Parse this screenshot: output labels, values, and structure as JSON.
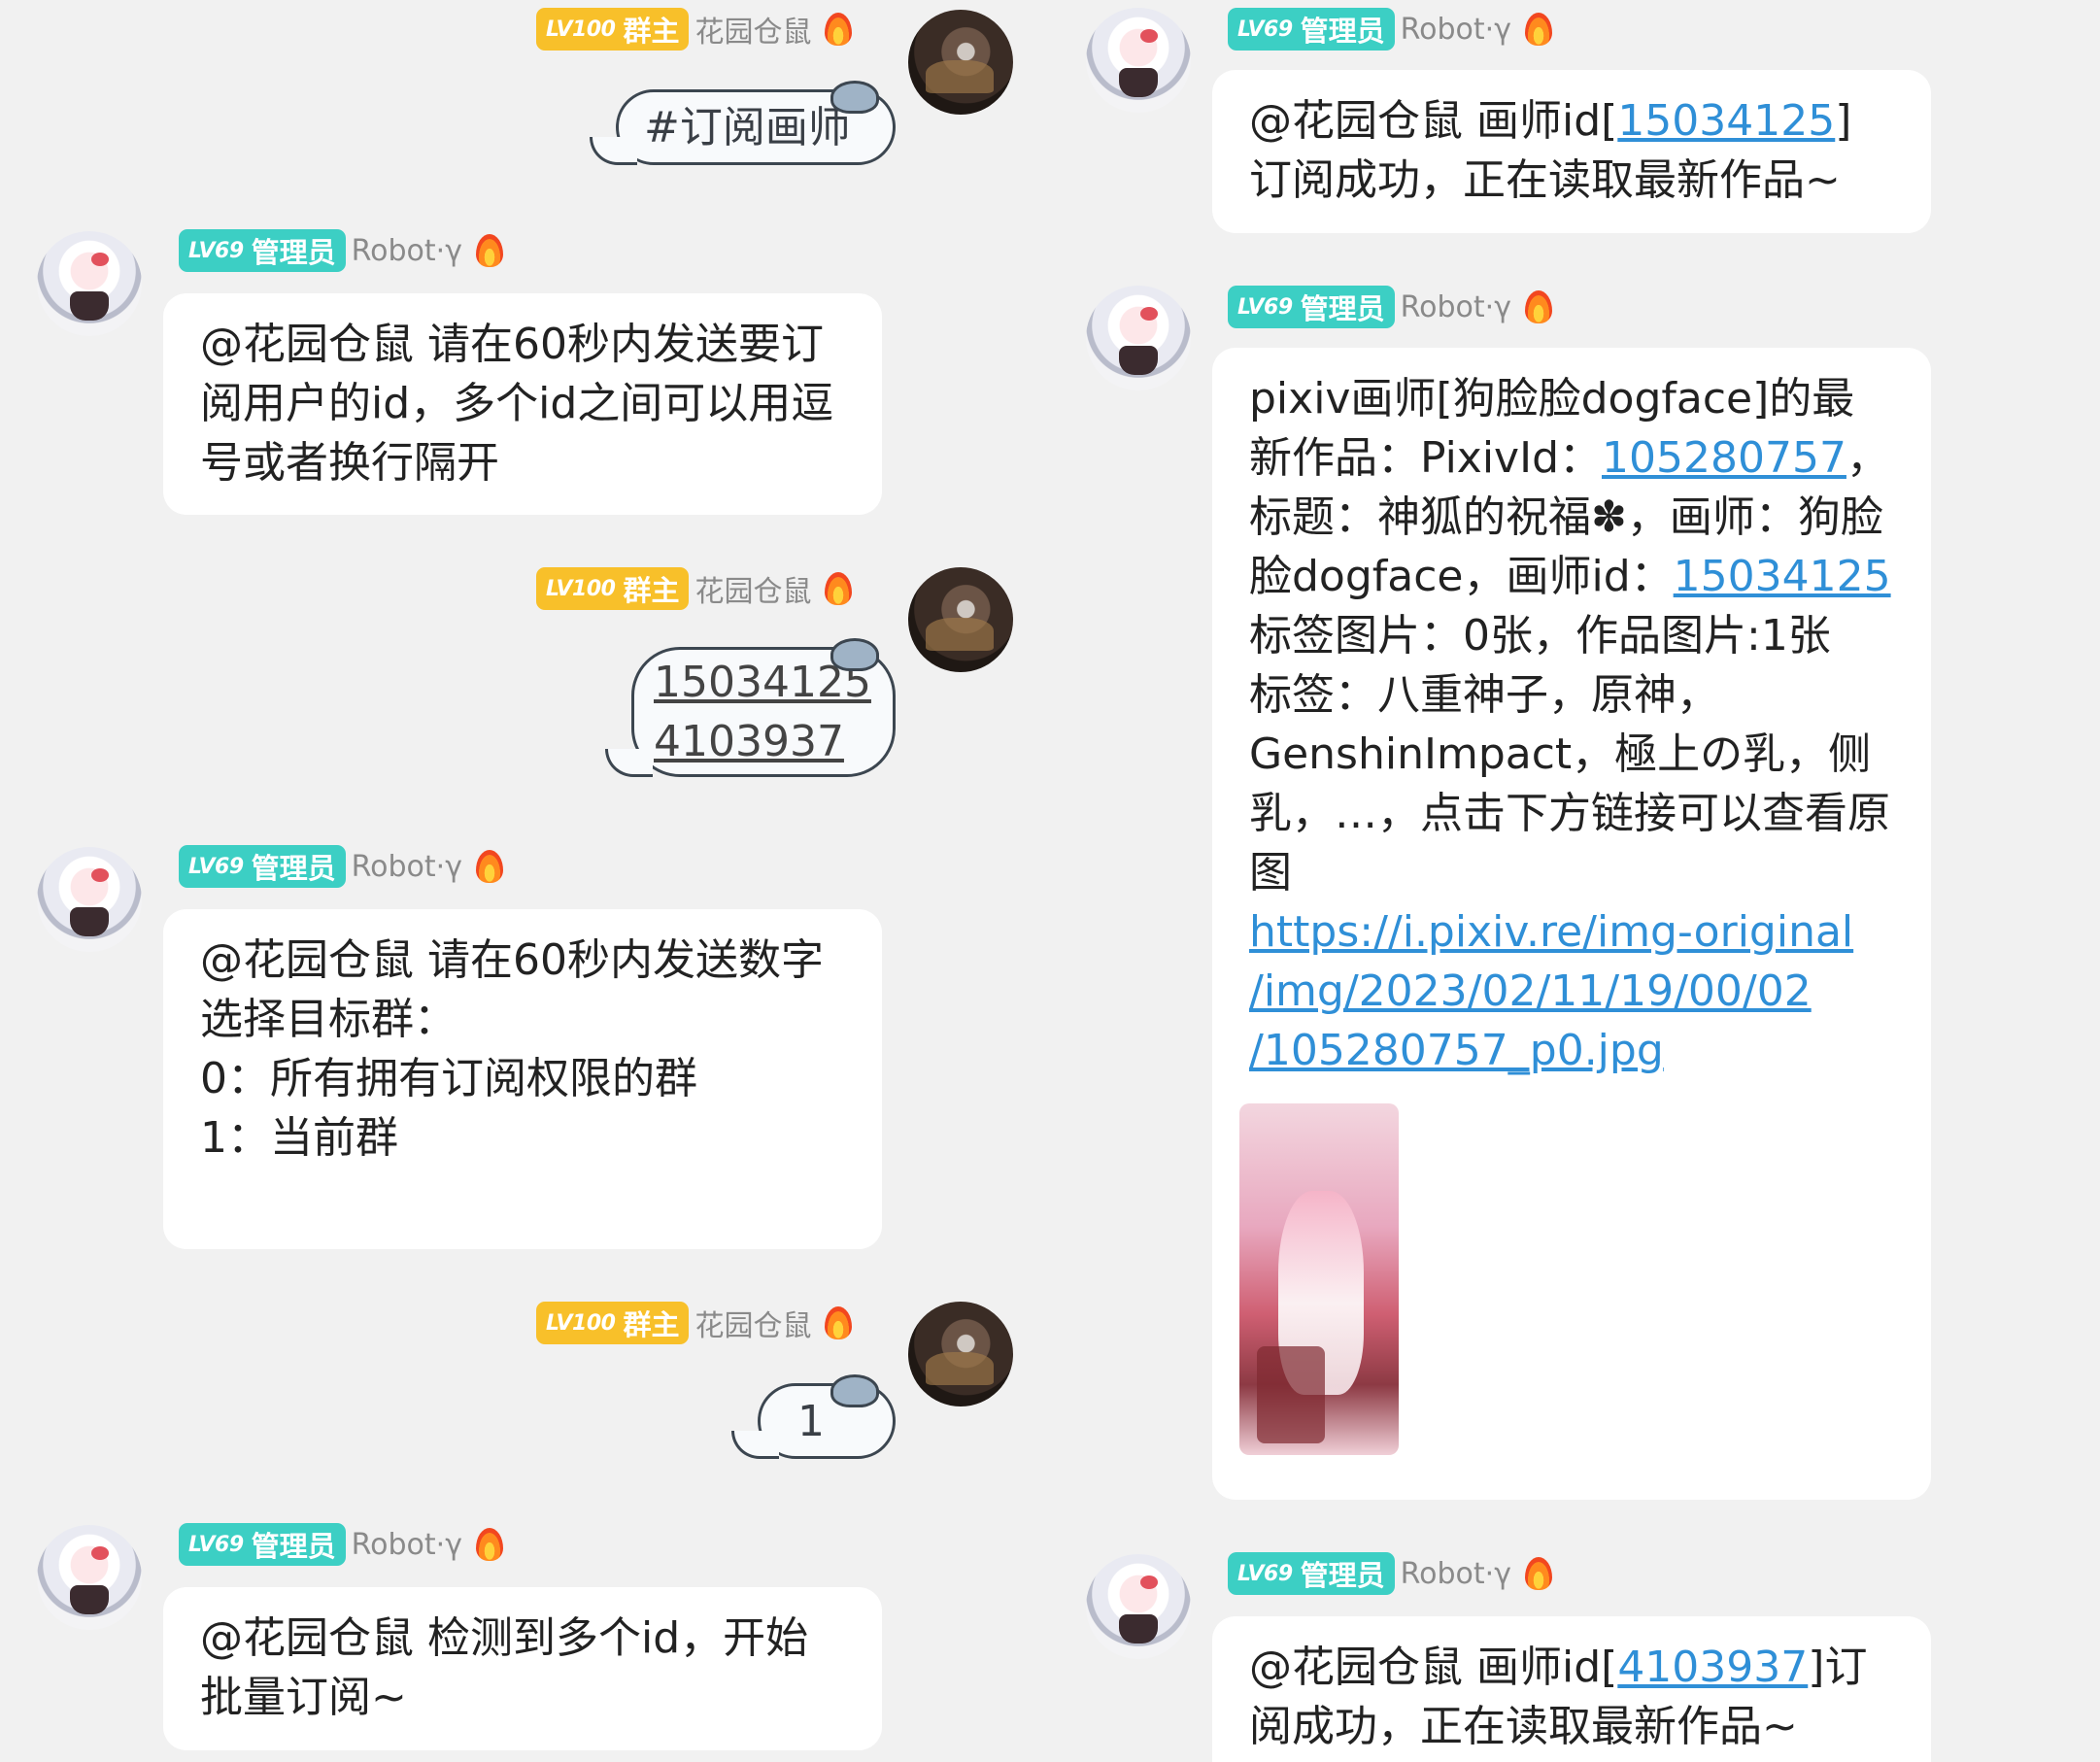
{
  "roles": {
    "admin": {
      "level": "LV69",
      "role": "管理员",
      "name": "Robot·γ"
    },
    "owner": {
      "level": "LV100",
      "role": "群主",
      "name": "花园仓鼠"
    }
  },
  "left_messages": [
    {
      "text": "#订阅画师"
    },
    {
      "text": "@花园仓鼠 请在60秒内发送要订阅用户的id，多个id之间可以用逗号或者换行隔开"
    },
    {
      "line1": "15034125",
      "line2": "4103937"
    },
    {
      "line1": "@花园仓鼠 请在60秒内发送数字选择目标群：",
      "line2": "0：所有拥有订阅权限的群",
      "line3": "1：当前群"
    },
    {
      "text": "1"
    },
    {
      "text": "@花园仓鼠 检测到多个id，开始批量订阅~"
    }
  ],
  "right_messages": [
    {
      "pre": "@花园仓鼠 画师id[",
      "link": "15034125",
      "post": "]订阅成功，正在读取最新作品~"
    },
    {
      "p1": "pixiv画师[狗脸脸dogface]的最新作品：PixivId：",
      "pixiv_id": "105280757",
      "p2": "，标题：神狐的祝福✽，画师：狗脸脸dogface，画师id：",
      "artist_id": "15034125",
      "p3": "标签图片：0张，作品图片:1张",
      "p4": "标签：八重神子，原神，GenshinImpact，極上の乳，侧乳，…，点击下方链接可以查看原图",
      "url1": "https://i.pixiv.re/img-original",
      "url2": "/img/2023/02/11/19/00/02",
      "url3": "/105280757_p0.jpg"
    },
    {
      "pre": "@花园仓鼠 画师id[",
      "link": "4103937",
      "post": "]订阅成功，正在读取最新作品~"
    }
  ]
}
